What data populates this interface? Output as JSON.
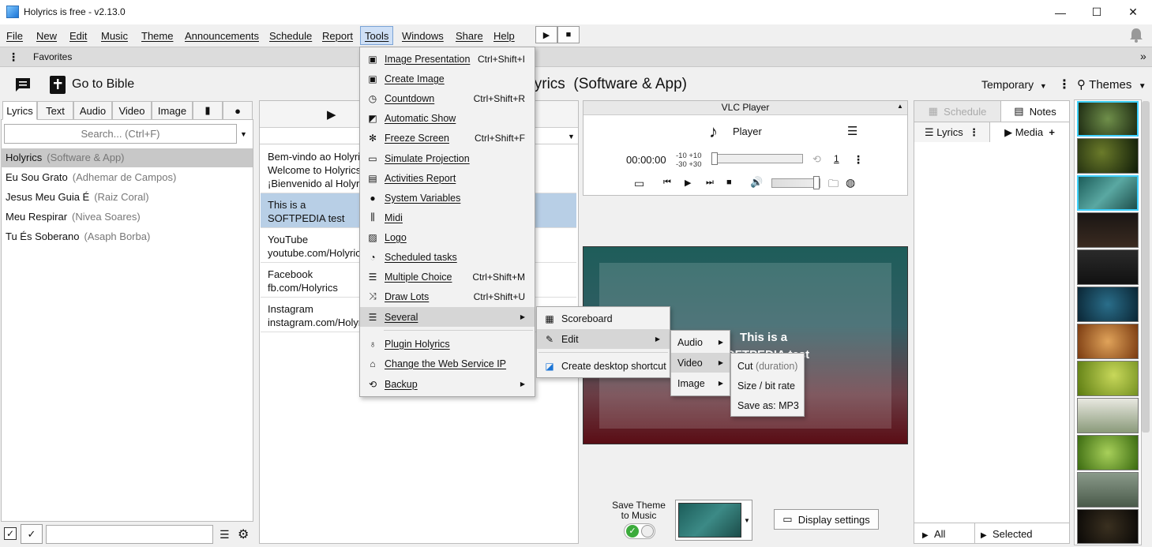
{
  "window": {
    "title": "Holyrics is free - v2.13.0",
    "minimize": "—",
    "maximize": "☐",
    "close": "✕"
  },
  "menubar": {
    "items": [
      "File",
      "New",
      "Edit",
      "Music",
      "Theme",
      "Announcements",
      "Schedule",
      "Report",
      "Tools",
      "Windows",
      "Share",
      "Help"
    ],
    "play": "▶",
    "stop": "■"
  },
  "favorites": {
    "label": "Favorites",
    "more": "»"
  },
  "toolbar": {
    "go_to_bible": "Go to Bible",
    "song_title": "Holyrics",
    "song_subtitle": "(Software & App)",
    "temporary": "Temporary",
    "themes": "Themes"
  },
  "left_tabs": [
    "Lyrics",
    "Text",
    "Audio",
    "Video",
    "Image"
  ],
  "search": {
    "placeholder": "Search... (Ctrl+F)"
  },
  "songs": [
    {
      "title": "Holyrics",
      "artist": "(Software & App)"
    },
    {
      "title": "Eu Sou Grato",
      "artist": "(Adhemar de Campos)"
    },
    {
      "title": "Jesus Meu Guia É",
      "artist": "(Raiz Coral)"
    },
    {
      "title": "Meu Respirar",
      "artist": "(Nivea Soares)"
    },
    {
      "title": "Tu És Soberano",
      "artist": "(Asaph Borba)"
    }
  ],
  "slides": [
    "Bem-vindo ao Holyrics\nWelcome to Holyrics\n¡Bienvenido al Holyrics",
    "This is a\nSOFTPEDIA test",
    "YouTube\nyoutube.com/Holyrics",
    "Facebook\nfb.com/Holyrics",
    "Instagram\ninstagram.com/Holyrics"
  ],
  "vlc": {
    "title": "VLC Player",
    "player_label": "Player",
    "time": "00:00:00",
    "skip_top": "-10 +10",
    "skip_bottom": "-30 +30",
    "count": "1"
  },
  "preview": {
    "text_line1": "This is a",
    "text_line2": "SOFTPEDIA test"
  },
  "bottom": {
    "save_theme_line1": "Save Theme",
    "save_theme_line2": "to Music",
    "display_settings": "Display settings"
  },
  "right_panel": {
    "schedule": "Schedule",
    "notes": "Notes",
    "lyrics": "Lyrics",
    "media": "Media",
    "all": "All",
    "selected": "Selected"
  },
  "tools_menu": [
    {
      "icon": "image-icon",
      "glyph": "▣",
      "label": "Image Presentation",
      "shortcut": "Ctrl+Shift+I"
    },
    {
      "icon": "image-icon",
      "glyph": "▣",
      "label": "Create Image",
      "shortcut": ""
    },
    {
      "icon": "timer-icon",
      "glyph": "◷",
      "label": "Countdown",
      "shortcut": "Ctrl+Shift+R"
    },
    {
      "icon": "slideshow-icon",
      "glyph": "◩",
      "label": "Automatic Show",
      "shortcut": ""
    },
    {
      "icon": "snowflake-icon",
      "glyph": "✻",
      "label": "Freeze Screen",
      "shortcut": "Ctrl+Shift+F"
    },
    {
      "icon": "monitor-icon",
      "glyph": "▭",
      "label": "Simulate Projection",
      "shortcut": ""
    },
    {
      "icon": "report-icon",
      "glyph": "▤",
      "label": "Activities Report",
      "shortcut": ""
    },
    {
      "icon": "alert-icon",
      "glyph": "●",
      "label": "System Variables",
      "shortcut": ""
    },
    {
      "icon": "midi-icon",
      "glyph": "⫼",
      "label": "Midi",
      "shortcut": ""
    },
    {
      "icon": "logo-icon",
      "glyph": "▨",
      "label": "Logo",
      "shortcut": ""
    },
    {
      "icon": "history-icon",
      "glyph": "◔",
      "label": "Scheduled tasks",
      "shortcut": ""
    },
    {
      "icon": "list-icon",
      "glyph": "☰",
      "label": "Multiple Choice",
      "shortcut": "Ctrl+Shift+M"
    },
    {
      "icon": "shuffle-icon",
      "glyph": "⤨",
      "label": "Draw Lots",
      "shortcut": "Ctrl+Shift+U"
    },
    {
      "icon": "list-icon",
      "glyph": "☰",
      "label": "Several",
      "shortcut": ""
    },
    {
      "icon": "bulb-icon",
      "glyph": "♁",
      "label": "Plugin Holyrics",
      "shortcut": ""
    },
    {
      "icon": "broadcast-icon",
      "glyph": "⌂",
      "label": "Change the Web Service IP",
      "shortcut": ""
    },
    {
      "icon": "restore-icon",
      "glyph": "⟲",
      "label": "Backup",
      "shortcut": ""
    }
  ],
  "several_menu": [
    {
      "icon": "scoreboard-icon",
      "glyph": "▦",
      "label": "Scoreboard"
    },
    {
      "icon": "pencil-icon",
      "glyph": "✎",
      "label": "Edit"
    },
    {
      "icon": "app-icon",
      "glyph": "◪",
      "label": "Create desktop shortcut"
    }
  ],
  "edit_menu": [
    "Audio",
    "Video",
    "Image"
  ],
  "video_menu": [
    {
      "label": "Cut",
      "extra": "(duration)"
    },
    {
      "label": "Size / bit rate",
      "extra": ""
    },
    {
      "label": "Save as: MP3",
      "extra": ""
    }
  ],
  "colors": {
    "selection": "#b8cfe6",
    "menu_highlight": "#d6d6d6",
    "accent": "#1a74d6"
  }
}
